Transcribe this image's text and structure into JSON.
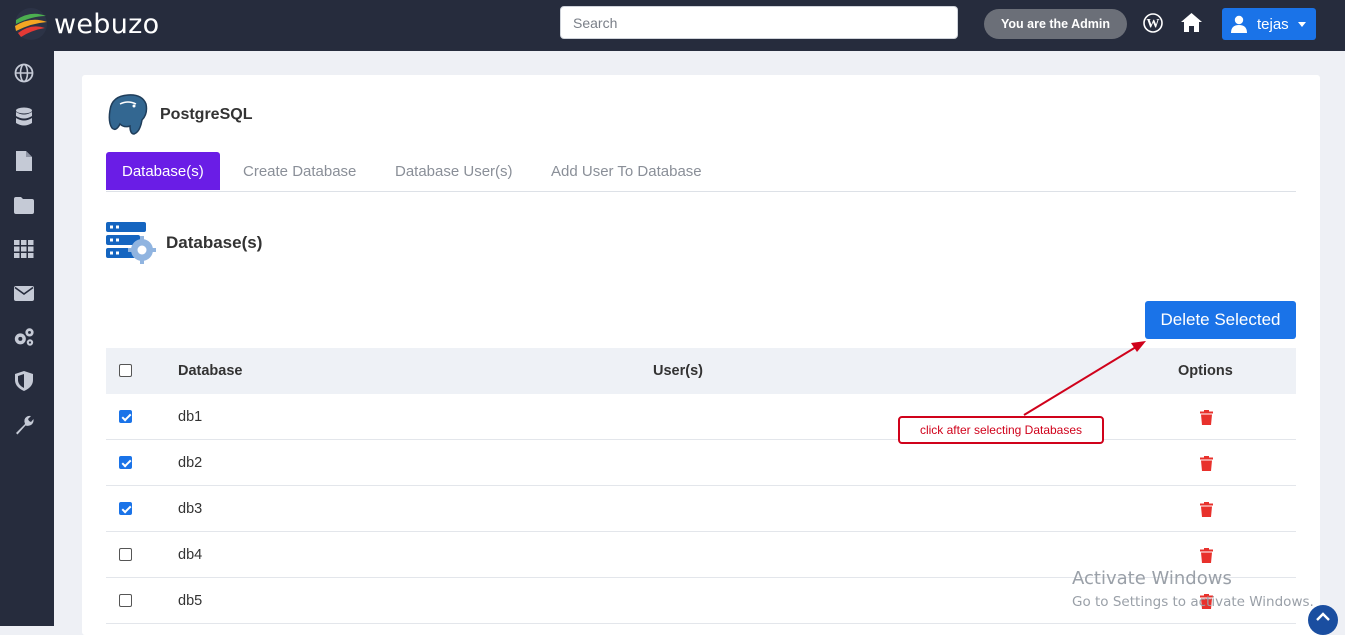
{
  "topbar": {
    "brand": "webuzo",
    "search_placeholder": "Search",
    "admin_badge": "You are the Admin",
    "user_name": "tejas"
  },
  "sidebar": {
    "icons": [
      "globe-icon",
      "database-icon",
      "file-icon",
      "folder-icon",
      "grid-icon",
      "mail-icon",
      "gears-icon",
      "shield-icon",
      "wrench-icon"
    ]
  },
  "page": {
    "title": "PostgreSQL",
    "tabs": [
      "Database(s)",
      "Create Database",
      "Database User(s)",
      "Add User To Database"
    ],
    "active_tab": "Database(s)",
    "section_title": "Database(s)",
    "delete_button": "Delete Selected"
  },
  "table": {
    "headers": {
      "database": "Database",
      "users": "User(s)",
      "options": "Options"
    },
    "rows": [
      {
        "name": "db1",
        "checked": true
      },
      {
        "name": "db2",
        "checked": true
      },
      {
        "name": "db3",
        "checked": true
      },
      {
        "name": "db4",
        "checked": false
      },
      {
        "name": "db5",
        "checked": false
      }
    ]
  },
  "annotation": {
    "text": "click after selecting Databases"
  },
  "watermark": {
    "line1": "Activate Windows",
    "line2": "Go to Settings to activate Windows."
  },
  "colors": {
    "topbar": "#262c3d",
    "accent_blue": "#1a73e8",
    "active_tab": "#6a1de6",
    "trash_red": "#e8312c",
    "annotation_red": "#d0021b"
  }
}
